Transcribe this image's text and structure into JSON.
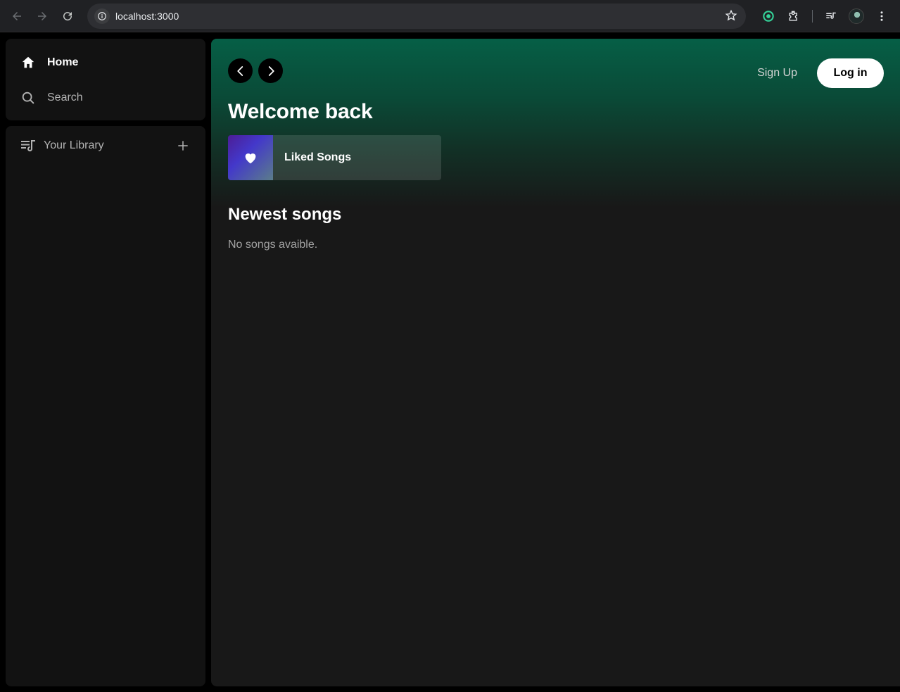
{
  "browser": {
    "url": "localhost:3000"
  },
  "sidebar": {
    "items": [
      {
        "label": "Home",
        "icon": "home-icon"
      },
      {
        "label": "Search",
        "icon": "search-icon"
      }
    ],
    "library": {
      "label": "Your Library"
    }
  },
  "header": {
    "signup_label": "Sign Up",
    "login_label": "Log in",
    "title": "Welcome back",
    "liked_card": {
      "label": "Liked Songs"
    }
  },
  "newest": {
    "title": "Newest songs",
    "empty_text": "No songs avaible."
  },
  "colors": {
    "accent_green": "#065f46",
    "panel": "#121212",
    "main_bg": "#181818"
  }
}
